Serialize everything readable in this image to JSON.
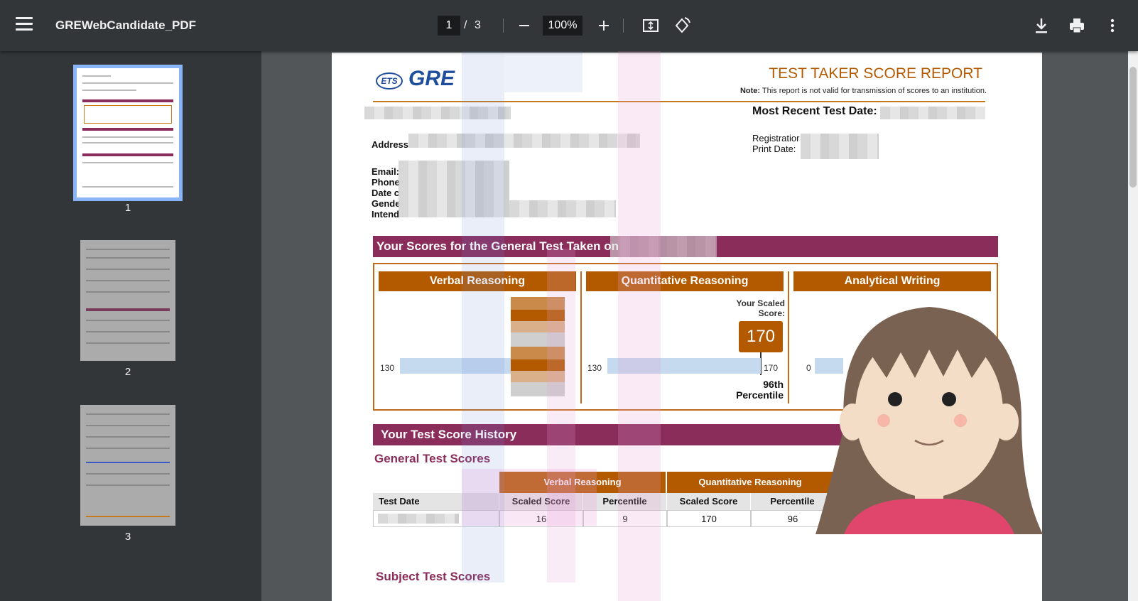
{
  "toolbar": {
    "title": "GREWebCandidate_PDF",
    "page_current": "1",
    "page_separator": "/",
    "page_total": "3",
    "zoom": "100%"
  },
  "thumbnails": [
    {
      "label": "1",
      "selected": true
    },
    {
      "label": "2",
      "selected": false
    },
    {
      "label": "3",
      "selected": false
    }
  ],
  "report": {
    "logo_ets": "ETS",
    "logo_gre": "GRE",
    "title": "TEST TAKER SCORE REPORT",
    "note_label": "Note:",
    "note_text": "This report is not valid for transmission of scores to an institution.",
    "most_recent_label": "Most Recent Test Date:",
    "address_label": "Address",
    "email_label": "Email:",
    "phone_label": "Phone",
    "date_label": "Date c",
    "gender_label": "Gende",
    "intended_label": "Intend",
    "registration_label": "Registratior",
    "print_date_label": "Print Date:",
    "scores_section": "Your Scores for the General Test Taken on",
    "verbal_head": "Verbal Reasoning",
    "quant_head": "Quantitative Reasoning",
    "writing_head": "Analytical Writing",
    "your_scaled": "Your Scaled",
    "score_word": "Score:",
    "verbal_min": "130",
    "quant_min": "130",
    "quant_max": "170",
    "quant_score": "170",
    "quant_pct_line1": "96th",
    "quant_pct_line2": "Percentile",
    "writing_min": "0",
    "history_section": "Your Test Score History",
    "general_scores": "General Test Scores",
    "subject_scores": "Subject Test Scores",
    "table": {
      "group_verbal": "Verbal Reasoning",
      "group_quant": "Quantitative Reasoning",
      "col_date": "Test Date",
      "col_v_scaled": "Scaled Score",
      "col_v_pct": "Percentile",
      "col_q_scaled": "Scaled Score",
      "col_q_pct": "Percentile",
      "row_v_scaled": "16",
      "row_v_pct": "9",
      "row_q_scaled": "170",
      "row_q_pct": "96"
    }
  },
  "colors": {
    "toolbar": "#323639",
    "accent_orange": "#b35a00",
    "accent_maroon": "#8a2d5b",
    "gre_blue": "#1f4e9c"
  }
}
